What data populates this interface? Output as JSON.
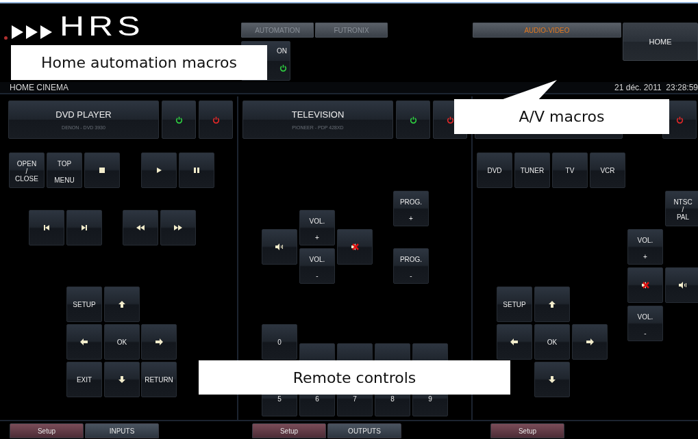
{
  "logo": {
    "text": "HRS"
  },
  "top_tabs": [
    {
      "label": "AUTOMATION",
      "selected": false
    },
    {
      "label": "FUTRONIX",
      "selected": false
    }
  ],
  "macro_button": {
    "label": "ON"
  },
  "av_tab": {
    "label": "AUDIO-VIDEO",
    "selected": true
  },
  "home_button": {
    "label": "HOME"
  },
  "info_bar": {
    "room": "HOME CINEMA",
    "date": "21 déc. 2011",
    "time": "23:28:59"
  },
  "panels": [
    {
      "title": "DVD PLAYER",
      "subtitle": "DENON - DVD 3930",
      "powers": [
        {
          "kind": "on"
        },
        {
          "kind": "off"
        }
      ],
      "buttons": [
        {
          "kind": "text",
          "lines": [
            "OPEN",
            "/",
            "CLOSE"
          ]
        },
        {
          "kind": "text",
          "lines": [
            "TOP",
            "MENU"
          ]
        },
        {
          "kind": "stop"
        },
        {
          "kind": "play"
        },
        {
          "kind": "pause"
        },
        {
          "kind": "prev"
        },
        {
          "kind": "next"
        },
        {
          "kind": "rewind"
        },
        {
          "kind": "forward"
        },
        {
          "kind": "text",
          "lines": [
            "SETUP"
          ]
        },
        {
          "kind": "up"
        },
        {
          "kind": "left"
        },
        {
          "kind": "text",
          "lines": [
            "OK"
          ]
        },
        {
          "kind": "right"
        },
        {
          "kind": "text",
          "lines": [
            "EXIT"
          ]
        },
        {
          "kind": "down"
        },
        {
          "kind": "text",
          "lines": [
            "RETURN"
          ]
        }
      ],
      "footer": [
        {
          "label": "Setup",
          "kind": "setup"
        },
        {
          "label": "INPUTS",
          "kind": "normal"
        }
      ]
    },
    {
      "title": "TELEVISION",
      "subtitle": "PIONEER - PDP 428XD",
      "powers": [
        {
          "kind": "on"
        },
        {
          "kind": "off"
        }
      ],
      "buttons": [
        {
          "kind": "volume"
        },
        {
          "kind": "text",
          "lines": [
            "VOL.",
            "+"
          ]
        },
        {
          "kind": "mute"
        },
        {
          "kind": "text",
          "lines": [
            "VOL.",
            "-"
          ]
        },
        {
          "kind": "text",
          "lines": [
            "PROG.",
            "+"
          ]
        },
        {
          "kind": "text",
          "lines": [
            "PROG.",
            "-"
          ]
        },
        {
          "kind": "text",
          "lines": [
            "0"
          ]
        },
        {
          "kind": "blank"
        },
        {
          "kind": "blank"
        },
        {
          "kind": "blank"
        },
        {
          "kind": "blank"
        },
        {
          "kind": "text",
          "lines": [
            "5"
          ]
        },
        {
          "kind": "text",
          "lines": [
            "6"
          ]
        },
        {
          "kind": "text",
          "lines": [
            "7"
          ]
        },
        {
          "kind": "text",
          "lines": [
            "8"
          ]
        },
        {
          "kind": "text",
          "lines": [
            "9"
          ]
        }
      ],
      "footer": [
        {
          "label": "Setup",
          "kind": "setup"
        },
        {
          "label": "OUTPUTS",
          "kind": "normal"
        }
      ]
    },
    {
      "powers": [
        {
          "kind": "off"
        }
      ],
      "buttons": [
        {
          "kind": "text",
          "lines": [
            "DVD"
          ]
        },
        {
          "kind": "text",
          "lines": [
            "TUNER"
          ]
        },
        {
          "kind": "text",
          "lines": [
            "TV"
          ]
        },
        {
          "kind": "text",
          "lines": [
            "VCR"
          ]
        },
        {
          "kind": "text",
          "lines": [
            "NTSC",
            "/",
            "PAL"
          ]
        },
        {
          "kind": "text",
          "lines": [
            "VOL.",
            "+"
          ]
        },
        {
          "kind": "mute"
        },
        {
          "kind": "volume"
        },
        {
          "kind": "text",
          "lines": [
            "VOL.",
            "-"
          ]
        },
        {
          "kind": "text",
          "lines": [
            "SETUP"
          ]
        },
        {
          "kind": "up"
        },
        {
          "kind": "left"
        },
        {
          "kind": "text",
          "lines": [
            "OK"
          ]
        },
        {
          "kind": "right"
        },
        {
          "kind": "down"
        }
      ],
      "footer": [
        {
          "label": "Setup",
          "kind": "setup"
        }
      ]
    }
  ],
  "callouts": [
    {
      "text": "Home automation macros",
      "kind": "plain"
    },
    {
      "text": "A/V macros",
      "kind": "pointer"
    },
    {
      "text": "Remote controls",
      "kind": "plain"
    }
  ]
}
